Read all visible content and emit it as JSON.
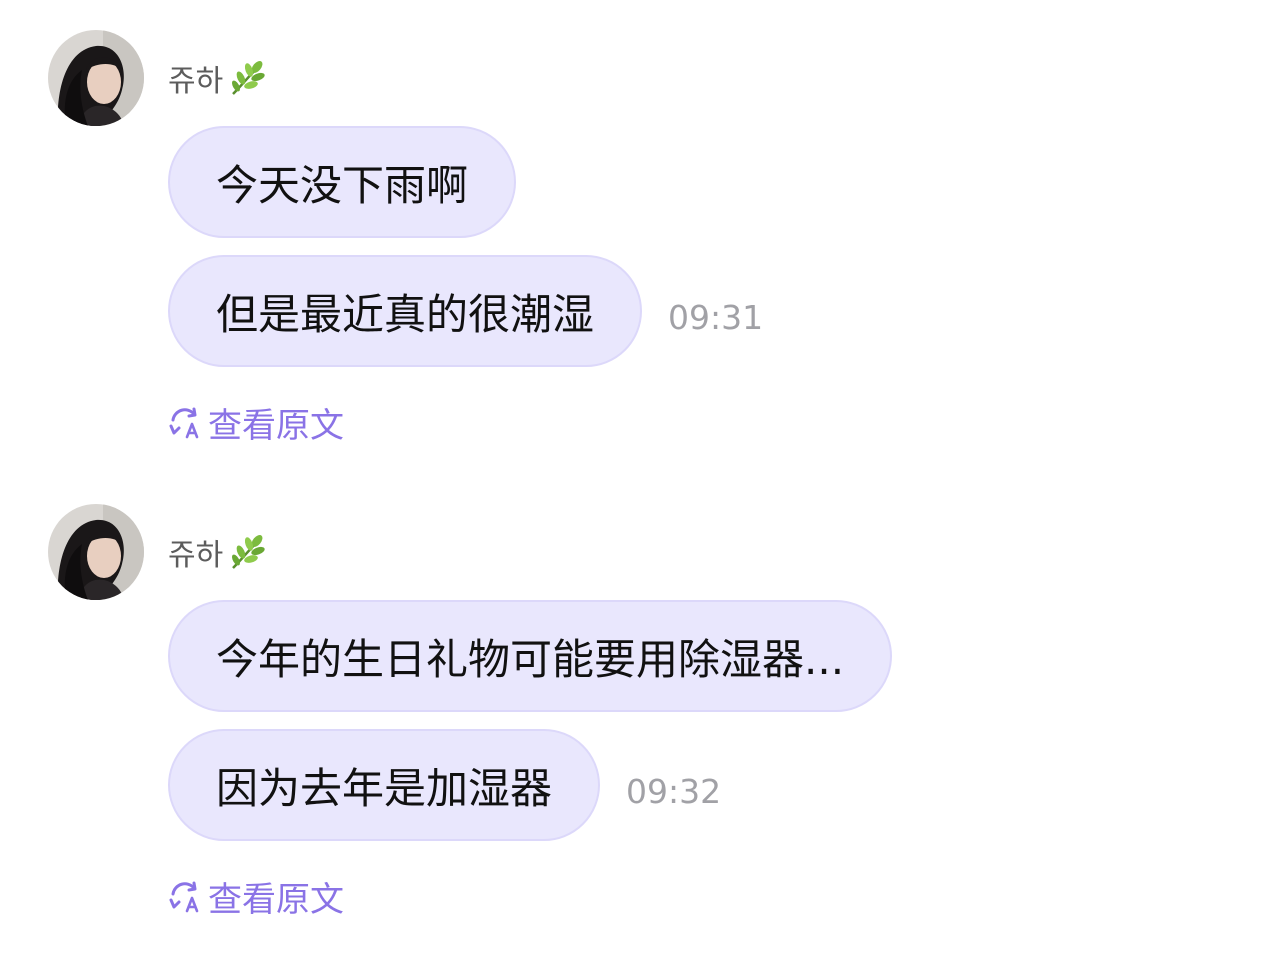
{
  "groups": [
    {
      "sender": "쥬하",
      "sender_icon": "leaf-icon",
      "messages": [
        {
          "text": "今天没下雨啊",
          "time": ""
        },
        {
          "text": "但是最近真的很潮湿",
          "time": "09:31"
        }
      ],
      "translate_label": "查看原文",
      "translate_icon": "translate-refresh-icon"
    },
    {
      "sender": "쥬하",
      "sender_icon": "leaf-icon",
      "messages": [
        {
          "text": "今年的生日礼物可能要用除湿器...",
          "time": ""
        },
        {
          "text": "因为去年是加湿器",
          "time": "09:32"
        }
      ],
      "translate_label": "查看原文",
      "translate_icon": "translate-refresh-icon"
    }
  ],
  "colors": {
    "bubble": "#e9e7fd",
    "bubble_border": "#dcd8fa",
    "accent": "#8a73e6",
    "time": "#a1a1a6",
    "sender": "#5c5c5c"
  }
}
